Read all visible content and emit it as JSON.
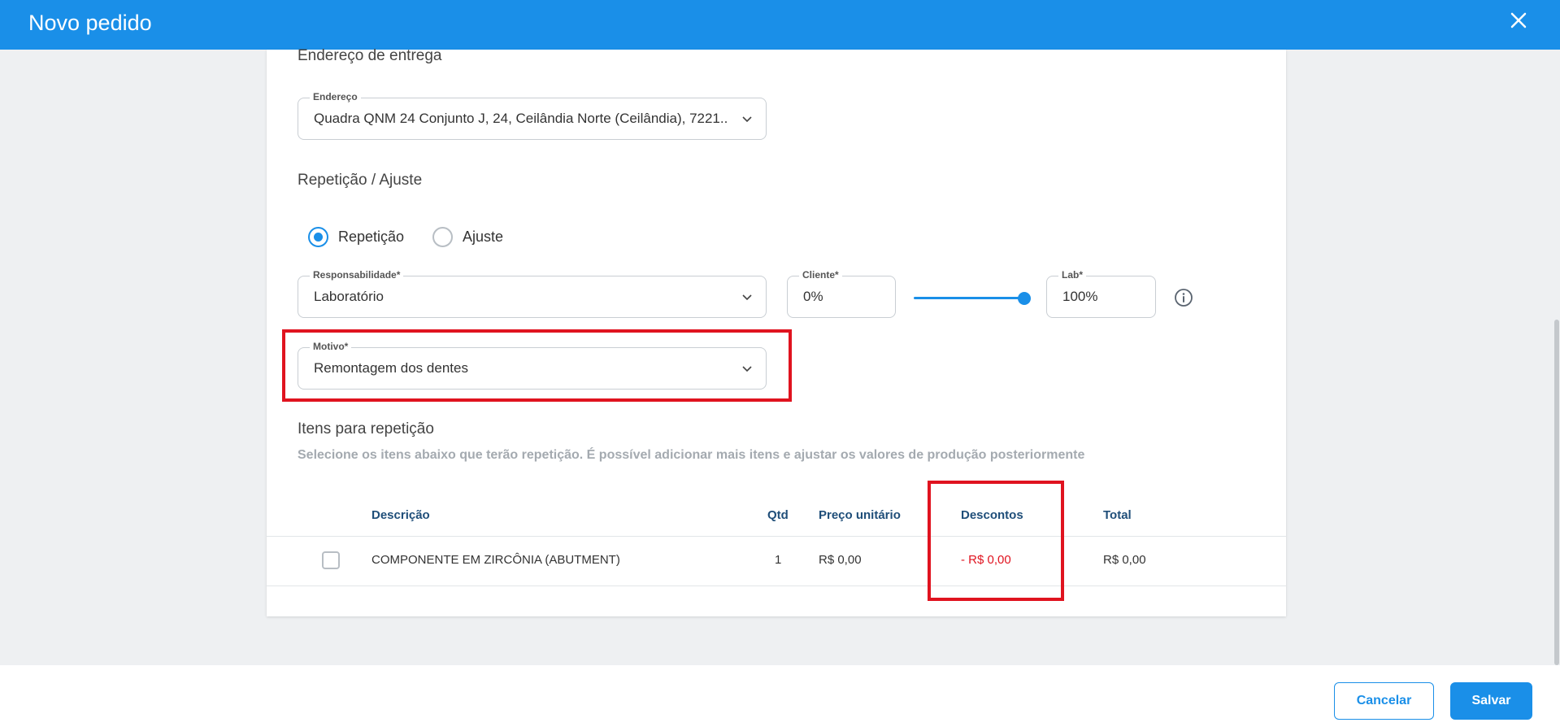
{
  "header": {
    "title": "Novo pedido"
  },
  "delivery": {
    "section_title": "Endereço de entrega",
    "address_label": "Endereço",
    "address_value": "Quadra QNM 24 Conjunto J, 24, Ceilândia Norte (Ceilândia), 7221..."
  },
  "repetition": {
    "section_title": "Repetição / Ajuste",
    "options": [
      {
        "label": "Repetição",
        "checked": true
      },
      {
        "label": "Ajuste",
        "checked": false
      }
    ],
    "responsibility_label": "Responsabilidade",
    "responsibility_value": "Laboratório",
    "client_label": "Cliente",
    "client_value": "0%",
    "lab_label": "Lab",
    "lab_value": "100%",
    "lab_share": 1.0,
    "reason_label": "Motivo",
    "reason_value": "Remontagem dos dentes",
    "required_mark": "*"
  },
  "items": {
    "section_title": "Itens para repetição",
    "subtitle": "Selecione os itens abaixo que terão repetição. É possível adicionar mais itens e ajustar os valores de produção posteriormente",
    "columns": [
      "Descrição",
      "Qtd",
      "Preço unitário",
      "Descontos",
      "Total"
    ],
    "rows": [
      {
        "description": "COMPONENTE EM ZIRCÔNIA (ABUTMENT)",
        "qty": "1",
        "unit_price": "R$ 0,00",
        "discount": "- R$ 0,00",
        "total": "R$ 0,00",
        "checked": false
      }
    ]
  },
  "footer": {
    "cancel_label": "Cancelar",
    "save_label": "Salvar"
  },
  "colors": {
    "primary": "#1a8fe8",
    "highlight": "#e0131f",
    "discount": "#e0131f"
  },
  "icons": {
    "close": "close-icon",
    "chevron": "chevron-down-icon",
    "info": "info-icon"
  }
}
